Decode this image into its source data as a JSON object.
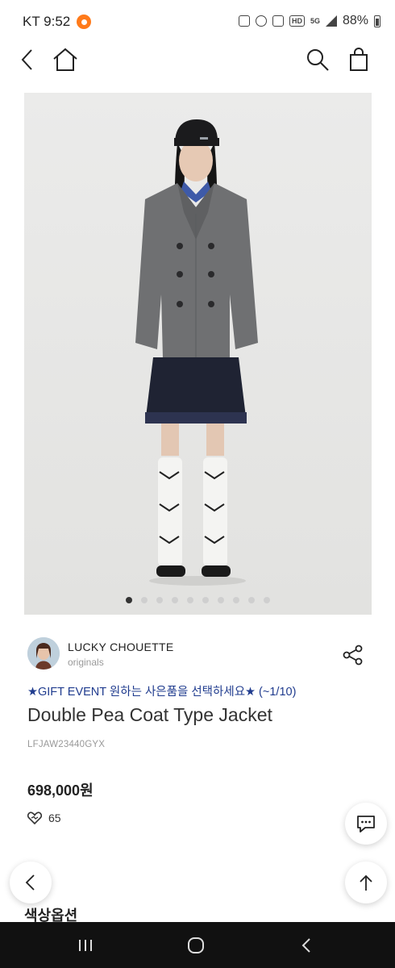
{
  "status": {
    "carrier_time": "KT 9:52",
    "battery": "88%",
    "hd": "HD",
    "net": "5G"
  },
  "product": {
    "brand": "LUCKY CHOUETTE",
    "brand_sub": "originals",
    "gift_event": "★GIFT EVENT 원하는 사은품을 선택하세요★ (~1/10)",
    "title": "Double Pea Coat Type Jacket",
    "code": "LFJAW23440GYX",
    "price": "698,000원",
    "likes": "65",
    "image_count": 10,
    "active_image": 1
  },
  "section": {
    "color_options": "색상옵션"
  },
  "icons": [
    "back-icon",
    "home-icon",
    "search-icon",
    "bag-icon",
    "share-icon",
    "heart-icon",
    "chat-icon",
    "arrow-up-icon",
    "recent-apps-icon",
    "home-circle-icon",
    "system-back-icon"
  ],
  "colors": {
    "gift_text": "#1f3b8e",
    "system_bar": "#111111"
  }
}
